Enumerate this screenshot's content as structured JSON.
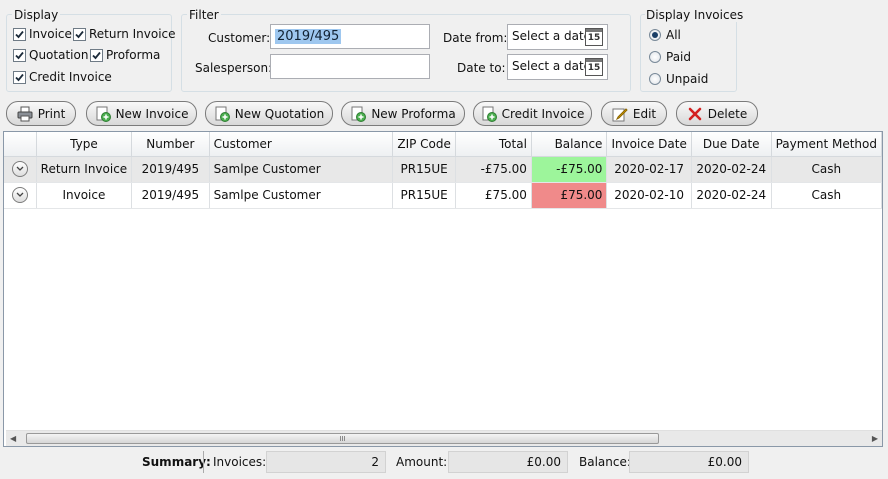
{
  "display": {
    "title": "Display",
    "options": [
      {
        "label": "Invoice",
        "checked": true
      },
      {
        "label": "Return Invoice",
        "checked": true
      },
      {
        "label": "Quotation",
        "checked": true
      },
      {
        "label": "Proforma",
        "checked": true
      },
      {
        "label": "Credit Invoice",
        "checked": true
      }
    ]
  },
  "filter": {
    "title": "Filter",
    "customer_label": "Customer:",
    "customer_value": "2019/495",
    "salesperson_label": "Salesperson:",
    "salesperson_value": "",
    "date_from_label": "Date from:",
    "date_to_label": "Date to:",
    "date_placeholder": "Select a date",
    "calendar_day": "15"
  },
  "display_invoices": {
    "title": "Display Invoices",
    "options": [
      {
        "label": "All",
        "selected": true
      },
      {
        "label": "Paid",
        "selected": false
      },
      {
        "label": "Unpaid",
        "selected": false
      }
    ]
  },
  "toolbar": {
    "print": "Print",
    "new_invoice": "New Invoice",
    "new_quotation": "New Quotation",
    "new_proforma": "New Proforma",
    "credit_invoice": "Credit Invoice",
    "edit": "Edit",
    "delete": "Delete"
  },
  "grid": {
    "columns": [
      "Type",
      "Number",
      "Customer",
      "ZIP Code",
      "Total",
      "Balance",
      "Invoice Date",
      "Due Date",
      "Payment Method"
    ],
    "rows": [
      {
        "type": "Return Invoice",
        "number": "2019/495",
        "customer": "Samlpe Customer",
        "zip": "PR15UE",
        "total": "-£75.00",
        "balance": "-£75.00",
        "invoice_date": "2020-02-17",
        "due_date": "2020-02-24",
        "payment": "Cash"
      },
      {
        "type": "Invoice",
        "number": "2019/495",
        "customer": "Samlpe Customer",
        "zip": "PR15UE",
        "total": "£75.00",
        "balance": "£75.00",
        "invoice_date": "2020-02-10",
        "due_date": "2020-02-24",
        "payment": "Cash"
      }
    ],
    "scroll_grip": "III"
  },
  "summary": {
    "label": "Summary:",
    "invoices_label": "Invoices:",
    "invoices_value": "2",
    "amount_label": "Amount:",
    "amount_value": "£0.00",
    "balance_label": "Balance:",
    "balance_value": "£0.00"
  },
  "colors": {
    "positive_balance": "#9df59b",
    "negative_balance": "#f08a8a"
  }
}
